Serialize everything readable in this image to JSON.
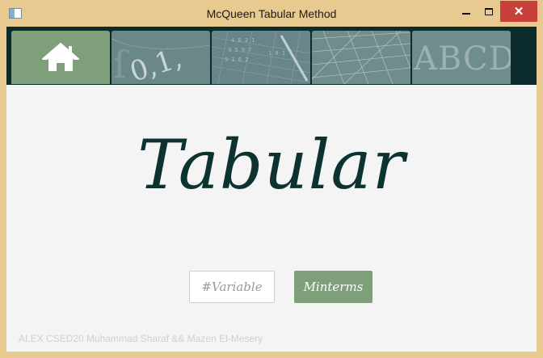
{
  "window": {
    "title": "McQueen Tabular Method",
    "close_glyph": "✕"
  },
  "nav": {
    "items": [
      {
        "name": "home",
        "icon": "home-icon",
        "active": true
      },
      {
        "name": "numbers",
        "image_text": "0,1,"
      },
      {
        "name": "grid-numbers",
        "image_text": ""
      },
      {
        "name": "graph-paper",
        "image_text": ""
      },
      {
        "name": "letters",
        "image_text": "ABCD"
      }
    ]
  },
  "main": {
    "heading": "Tabular",
    "variable_input": {
      "value": "",
      "placeholder": "#Variable"
    },
    "minterms_button": "Minterms"
  },
  "footer": {
    "credit": "ALEX CSED20 Muhammad Sharaf && Mazen El-Mesery"
  },
  "colors": {
    "accent": "#7f9f7b",
    "dark": "#0c2b2c",
    "heading": "#0d3232",
    "window_frame": "#e8c98f",
    "close": "#c7403a"
  }
}
